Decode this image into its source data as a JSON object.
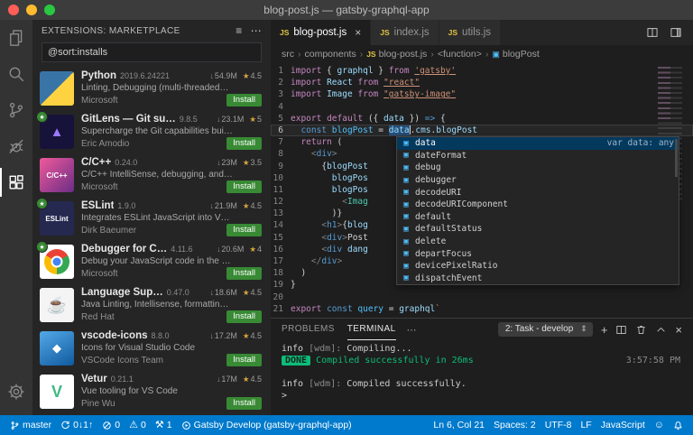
{
  "window": {
    "title": "blog-post.js — gatsby-graphql-app"
  },
  "icons": {
    "filter": "≡",
    "more": "⋯",
    "overflow": "⋯",
    "crumb_sep": "›",
    "js": "JS",
    "variable": "▣",
    "select_arrows": "⇕",
    "installs": "↓",
    "rating": "★",
    "warning": "⚠",
    "tools": "⚒",
    "smiley": "☺",
    "plus": "+",
    "close": "×"
  },
  "colors": {
    "accent": "#007ACC",
    "install_green": "#388A34",
    "done_green": "#0DBC79",
    "badge_green": "#388A34"
  },
  "activity_bar": {
    "items": [
      {
        "name": "explorer"
      },
      {
        "name": "search"
      },
      {
        "name": "source-control"
      },
      {
        "name": "debug"
      },
      {
        "name": "extensions",
        "active": true
      }
    ],
    "bottom": [
      {
        "name": "settings"
      }
    ]
  },
  "sidebar": {
    "header": {
      "title": "EXTENSIONS: MARKETPLACE"
    },
    "search": {
      "value": "@sort:installs"
    },
    "extensions": [
      {
        "name": "Python",
        "version": "2019.6.24221",
        "installs": "54.9M",
        "rating": "4.5",
        "description": "Linting, Debugging (multi-threaded…",
        "author": "Microsoft",
        "action": "Install",
        "badge": false,
        "icon": "python",
        "icon_text": ""
      },
      {
        "name": "GitLens — Git su…",
        "version": "9.8.5",
        "installs": "23.1M",
        "rating": "5",
        "description": "Supercharge the Git capabilities bui…",
        "author": "Eric Amodio",
        "action": "Install",
        "badge": true,
        "icon": "gitlens",
        "icon_text": "▲"
      },
      {
        "name": "C/C++",
        "version": "0.24.0",
        "installs": "23M",
        "rating": "3.5",
        "description": "C/C++ IntelliSense, debugging, and…",
        "author": "Microsoft",
        "action": "Install",
        "badge": false,
        "icon": "cpp",
        "icon_text": "C/C++"
      },
      {
        "name": "ESLint",
        "version": "1.9.0",
        "installs": "21.9M",
        "rating": "4.5",
        "description": "Integrates ESLint JavaScript into V…",
        "author": "Dirk Baeumer",
        "action": "Install",
        "badge": true,
        "icon": "eslint",
        "icon_text": "ESLint"
      },
      {
        "name": "Debugger for C…",
        "version": "4.11.6",
        "installs": "20.6M",
        "rating": "4",
        "description": "Debug your JavaScript code in the …",
        "author": "Microsoft",
        "action": "Install",
        "badge": true,
        "icon": "chrome",
        "icon_text": ""
      },
      {
        "name": "Language Sup…",
        "version": "0.47.0",
        "installs": "18.6M",
        "rating": "4.5",
        "description": "Java Linting, Intellisense, formattin…",
        "author": "Red Hat",
        "action": "Install",
        "badge": false,
        "icon": "java",
        "icon_text": "☕"
      },
      {
        "name": "vscode-icons",
        "version": "8.8.0",
        "installs": "17.2M",
        "rating": "4.5",
        "description": "Icons for Visual Studio Code",
        "author": "VSCode Icons Team",
        "action": "Install",
        "badge": false,
        "icon": "vsicons",
        "icon_text": "◆"
      },
      {
        "name": "Vetur",
        "version": "0.21.1",
        "installs": "17M",
        "rating": "4.5",
        "description": "Vue tooling for VS Code",
        "author": "Pine Wu",
        "action": "Install",
        "badge": false,
        "icon": "vetur",
        "icon_text": "V"
      }
    ]
  },
  "editor": {
    "tabs": [
      {
        "label": "blog-post.js",
        "icon": "js",
        "active": true
      },
      {
        "label": "index.js",
        "icon": "js"
      },
      {
        "label": "utils.js",
        "icon": "js"
      }
    ],
    "actions": [
      {
        "name": "split-editor"
      },
      {
        "name": "editor-layout"
      }
    ],
    "breadcrumbs": [
      {
        "label": "src"
      },
      {
        "label": "components"
      },
      {
        "label": "blog-post.js",
        "icon": "js"
      },
      {
        "label": "<function>"
      },
      {
        "label": "blogPost",
        "icon": "variable"
      }
    ],
    "code_lines": [
      {
        "n": "1",
        "tokens": [
          [
            "import",
            "k"
          ],
          [
            " { ",
            "p"
          ],
          [
            "graphql",
            "v"
          ],
          [
            " } ",
            "p"
          ],
          [
            "from",
            "k"
          ],
          [
            " ",
            "p"
          ],
          [
            "'gatsby'",
            "su"
          ]
        ]
      },
      {
        "n": "2",
        "tokens": [
          [
            "import",
            "k"
          ],
          [
            " ",
            "p"
          ],
          [
            "React",
            "v"
          ],
          [
            " ",
            "p"
          ],
          [
            "from",
            "k"
          ],
          [
            " ",
            "p"
          ],
          [
            "\"react\"",
            "su"
          ]
        ]
      },
      {
        "n": "3",
        "tokens": [
          [
            "import",
            "k"
          ],
          [
            " ",
            "p"
          ],
          [
            "Image",
            "v"
          ],
          [
            " ",
            "p"
          ],
          [
            "from",
            "k"
          ],
          [
            " ",
            "p"
          ],
          [
            "\"gatsby-image\"",
            "su"
          ]
        ]
      },
      {
        "n": "4",
        "tokens": []
      },
      {
        "n": "5",
        "tokens": [
          [
            "export",
            "k"
          ],
          [
            " ",
            "p"
          ],
          [
            "default",
            "k"
          ],
          [
            " ({ ",
            "p"
          ],
          [
            "data",
            "v"
          ],
          [
            " }) ",
            "p"
          ],
          [
            "=>",
            "d"
          ],
          [
            " {",
            "p"
          ]
        ]
      },
      {
        "n": "6",
        "current": true,
        "tokens": [
          [
            "  ",
            "p"
          ],
          [
            "const",
            "d"
          ],
          [
            " ",
            "p"
          ],
          [
            "blogPost",
            "vc"
          ],
          [
            " = ",
            "p"
          ],
          [
            "data",
            "v hl"
          ],
          [
            ".",
            "p"
          ],
          [
            "cms",
            "v"
          ],
          [
            ".",
            "p"
          ],
          [
            "blogPost",
            "v"
          ]
        ]
      },
      {
        "n": "7",
        "tokens": [
          [
            "  ",
            "p"
          ],
          [
            "return",
            "k"
          ],
          [
            " (",
            "p"
          ]
        ]
      },
      {
        "n": "8",
        "tokens": [
          [
            "    ",
            "p"
          ],
          [
            "<",
            "g"
          ],
          [
            "div",
            "t"
          ],
          [
            ">",
            "g"
          ]
        ]
      },
      {
        "n": "9",
        "tokens": [
          [
            "      ",
            "p"
          ],
          [
            "{",
            "p"
          ],
          [
            "blogPost",
            "v"
          ]
        ]
      },
      {
        "n": "10",
        "tokens": [
          [
            "        ",
            "p"
          ],
          [
            "blogPos",
            "v"
          ]
        ]
      },
      {
        "n": "11",
        "tokens": [
          [
            "        ",
            "p"
          ],
          [
            "blogPos",
            "v"
          ]
        ]
      },
      {
        "n": "12",
        "tokens": [
          [
            "          ",
            "p"
          ],
          [
            "<",
            "g"
          ],
          [
            "Imag",
            "c"
          ]
        ]
      },
      {
        "n": "13",
        "tokens": [
          [
            "        ",
            "p"
          ],
          [
            ")}",
            "p"
          ]
        ]
      },
      {
        "n": "14",
        "tokens": [
          [
            "      ",
            "p"
          ],
          [
            "<",
            "g"
          ],
          [
            "h1",
            "t"
          ],
          [
            ">",
            "g"
          ],
          [
            "{",
            "p"
          ],
          [
            "blog",
            "v"
          ]
        ]
      },
      {
        "n": "15",
        "tokens": [
          [
            "      ",
            "p"
          ],
          [
            "<",
            "g"
          ],
          [
            "div",
            "t"
          ],
          [
            ">",
            "g"
          ],
          [
            "Post",
            "w"
          ]
        ]
      },
      {
        "n": "16",
        "tokens": [
          [
            "      ",
            "p"
          ],
          [
            "<",
            "g"
          ],
          [
            "div",
            "t"
          ],
          [
            " ",
            "p"
          ],
          [
            "dang",
            "v"
          ]
        ]
      },
      {
        "n": "17",
        "tokens": [
          [
            "    ",
            "p"
          ],
          [
            "</",
            "g"
          ],
          [
            "div",
            "t"
          ],
          [
            ">",
            "g"
          ]
        ]
      },
      {
        "n": "18",
        "tokens": [
          [
            "  ",
            "p"
          ],
          [
            ")",
            "p"
          ]
        ]
      },
      {
        "n": "19",
        "tokens": [
          [
            "}",
            "p"
          ]
        ]
      },
      {
        "n": "20",
        "tokens": []
      },
      {
        "n": "21",
        "tokens": [
          [
            "export",
            "k"
          ],
          [
            " ",
            "p"
          ],
          [
            "const",
            "d"
          ],
          [
            " ",
            "p"
          ],
          [
            "query",
            "vc"
          ],
          [
            " = ",
            "p"
          ],
          [
            "graphql",
            "v"
          ],
          [
            "`",
            "s"
          ]
        ]
      }
    ]
  },
  "suggest": {
    "items": [
      {
        "label": "data",
        "selected": true,
        "detail": "var data: any"
      },
      {
        "label": "dateFormat"
      },
      {
        "label": "debug"
      },
      {
        "label": "debugger"
      },
      {
        "label": "decodeURI"
      },
      {
        "label": "decodeURIComponent"
      },
      {
        "label": "default"
      },
      {
        "label": "defaultStatus"
      },
      {
        "label": "delete"
      },
      {
        "label": "departFocus"
      },
      {
        "label": "devicePixelRatio"
      },
      {
        "label": "dispatchEvent"
      }
    ]
  },
  "panel": {
    "tabs": [
      {
        "label": "PROBLEMS"
      },
      {
        "label": "TERMINAL",
        "active": true
      }
    ],
    "task_select": {
      "value": "2: Task - develop"
    },
    "actions": [
      {
        "name": "new-terminal"
      },
      {
        "name": "split-terminal"
      },
      {
        "name": "kill-terminal"
      },
      {
        "name": "maximize-panel"
      },
      {
        "name": "close-panel"
      }
    ],
    "terminal_lines": [
      [
        {
          "t": "info ",
          "c": "info"
        },
        {
          "t": "[wdm]: ",
          "c": "dim"
        },
        {
          "t": "Compiling...",
          "c": "plain"
        }
      ],
      [
        {
          "t": "DONE",
          "c": "badge"
        },
        {
          "t": " Compiled successfully in 26ms",
          "c": "green"
        },
        {
          "t": "3:57:58 PM",
          "c": "time"
        }
      ],
      [],
      [
        {
          "t": "info ",
          "c": "info"
        },
        {
          "t": "[wdm]: ",
          "c": "dim"
        },
        {
          "t": "Compiled successfully.",
          "c": "plain"
        }
      ],
      [
        {
          "t": ">",
          "c": "plain"
        }
      ]
    ]
  },
  "status_bar": {
    "left": [
      {
        "name": "git-branch",
        "icon": "branch",
        "label": "master"
      },
      {
        "name": "sync",
        "icon": "sync",
        "label": "0↓1↑"
      },
      {
        "name": "errors",
        "icon": "error",
        "label": "0"
      },
      {
        "name": "warnings",
        "icon": "warning",
        "label": "0"
      },
      {
        "name": "running-tasks",
        "icon": "tools",
        "label": "1"
      },
      {
        "name": "gatsby-develop",
        "icon": "play",
        "label": "Gatsby Develop (gatsby-graphql-app)"
      }
    ],
    "right": [
      {
        "name": "cursor-position",
        "label": "Ln 6, Col 21"
      },
      {
        "name": "indentation",
        "label": "Spaces: 2"
      },
      {
        "name": "encoding",
        "label": "UTF-8"
      },
      {
        "name": "eol",
        "label": "LF"
      },
      {
        "name": "language-mode",
        "label": "JavaScript"
      },
      {
        "name": "feedback",
        "icon": "smiley"
      },
      {
        "name": "notifications",
        "icon": "bell"
      }
    ]
  }
}
